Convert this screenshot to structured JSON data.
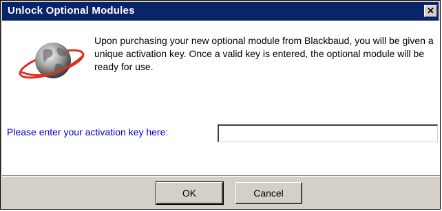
{
  "window": {
    "title": "Unlock Optional Modules",
    "close_label": "✕"
  },
  "message": {
    "text": "Upon purchasing your new optional module from Blackbaud, you will be given a unique activation key.  Once a valid key is entered, the optional module will be ready for use."
  },
  "icon": {
    "name": "globe-icon",
    "ring_color": "#e03020"
  },
  "activation": {
    "label": "Please enter your activation key here:",
    "value": "",
    "label_color": "#0000cc"
  },
  "buttons": {
    "ok_label": "OK",
    "cancel_label": "Cancel"
  },
  "colors": {
    "titlebar": "#0a246a",
    "face": "#d4d0c8"
  }
}
